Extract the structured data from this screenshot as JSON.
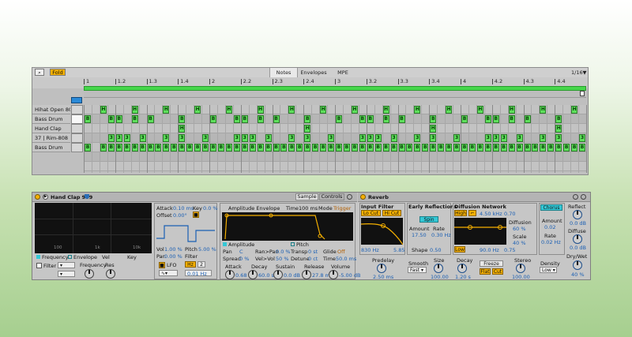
{
  "clip": {
    "toolbar": {
      "search_icon": "magnifier-icon",
      "fold_label": "Fold",
      "tabs": [
        "Notes",
        "Envelopes",
        "MPE"
      ],
      "quantize": "1/16",
      "quantize_arrow": "▼"
    },
    "ruler": [
      "1",
      "1.2",
      "1.3",
      "1.4",
      "2",
      "2.2",
      "2.3",
      "2.4",
      "3",
      "3.2",
      "3.3",
      "3.4",
      "4",
      "4.2",
      "4.3",
      "4.4"
    ],
    "loop_flag": "▢",
    "rows": [
      {
        "name": "Hihat Open 808",
        "glyph": "H"
      },
      {
        "name": "Bass Drum",
        "glyph": "B"
      },
      {
        "name": "Hand Clap",
        "glyph": "H"
      },
      {
        "name": "37 | Rim-808",
        "glyph": "3"
      },
      {
        "name": "Bass Drum",
        "glyph": "B"
      }
    ],
    "note_color": "#5ee05c"
  },
  "sampler": {
    "title": "Hand Clap 909",
    "tabs": [
      "Sample",
      "Controls"
    ],
    "graph_ticks": [
      "100",
      "1k",
      "10k"
    ],
    "legend": [
      "Frequency",
      "Envelope",
      "Vel",
      "Key"
    ],
    "filter": {
      "label": "Filter",
      "frequency": "Frequency",
      "res": "Res"
    },
    "attack": {
      "label": "Attack",
      "value": "0.10 ms"
    },
    "key": {
      "label": "Key",
      "value": "0.0 %"
    },
    "offset": {
      "label": "Offset",
      "value": "0.00°"
    },
    "vol": {
      "label": "Vol",
      "value": "1.00 %"
    },
    "pitch": {
      "label": "Pitch",
      "value": "5.00 %"
    },
    "pan": {
      "label": "Pan",
      "value": "0.00 %"
    },
    "filter_small": "Filter",
    "lfo": {
      "label": "LFO",
      "hz": "Hz",
      "num": "2",
      "rate": "0.01 Hz"
    },
    "envelope": {
      "title": "Amplitude Envelope",
      "time_label": "Time",
      "time_value": "100 ms",
      "mode_label": "Mode",
      "mode_value": "Trigger",
      "amplitude": "Amplitude",
      "pitch": "Pitch",
      "pan": "Pan",
      "pan_val": "C",
      "ran_pan": "Ran>Pan",
      "ran_pan_val": "0.0 %",
      "transp": "Transp",
      "transp_val": "0 st",
      "glide": "Glide",
      "glide_val": "Off",
      "spread": "Spread",
      "spread_val": "0 %",
      "vel_vol": "Vel>Vol",
      "vel_vol_val": "50 %",
      "detune": "Detune",
      "detune_val": "0 ct",
      "time2": "Time",
      "time2_val": "50.0 ms"
    },
    "knobs": [
      {
        "label": "Attack",
        "value": "0.68 ms"
      },
      {
        "label": "Decay",
        "value": "60.0 s"
      },
      {
        "label": "Sustain",
        "value": "0.0 dB"
      },
      {
        "label": "Release",
        "value": "27.8 ms"
      },
      {
        "label": "Volume",
        "value": "-5.00 dB"
      }
    ]
  },
  "reverb": {
    "title": "Reverb",
    "input_filter": {
      "title": "Input Filter",
      "lo_cut": "Lo Cut",
      "hi_cut": "Hi Cut",
      "freq": "830 Hz",
      "width": "5.85"
    },
    "early": {
      "title": "Early Reflections",
      "spin": "Spin",
      "amount_label": "Amount",
      "rate_label": "Rate",
      "amount": "17.50",
      "rate": "0.30 Hz",
      "shape_label": "Shape",
      "shape": "0.50"
    },
    "diffusion": {
      "title": "Diffusion Network",
      "high": "High",
      "freq": "4.50 kHz",
      "high_val": "0.70",
      "diffusion_label": "Diffusion",
      "diffusion": "60 %",
      "scale_label": "Scale",
      "scale": "40 %",
      "low": "Low",
      "low_freq": "90.0 Hz",
      "low_val": "0.75"
    },
    "chorus": {
      "label": "Chorus",
      "amount_label": "Amount",
      "amount": "0.02",
      "rate_label": "Rate",
      "rate": "0.02 Hz"
    },
    "reflect": {
      "label": "Reflect",
      "value": "0.0 dB"
    },
    "diffuse": {
      "label": "Diffuse",
      "value": "0.0 dB"
    },
    "predelay": {
      "label": "Predelay",
      "value": "2.50 ms"
    },
    "smooth": {
      "label": "Smooth",
      "value": "Fast"
    },
    "size": {
      "label": "Size",
      "value": "100.00"
    },
    "decay": {
      "label": "Decay",
      "value": "1.20 s"
    },
    "freeze": {
      "label": "Freeze",
      "flat": "Flat",
      "cut": "Cut"
    },
    "stereo": {
      "label": "Stereo",
      "value": "100.00"
    },
    "density": {
      "label": "Density",
      "value": "Low"
    },
    "drywet": {
      "label": "Dry/Wet",
      "value": "40 %"
    }
  }
}
